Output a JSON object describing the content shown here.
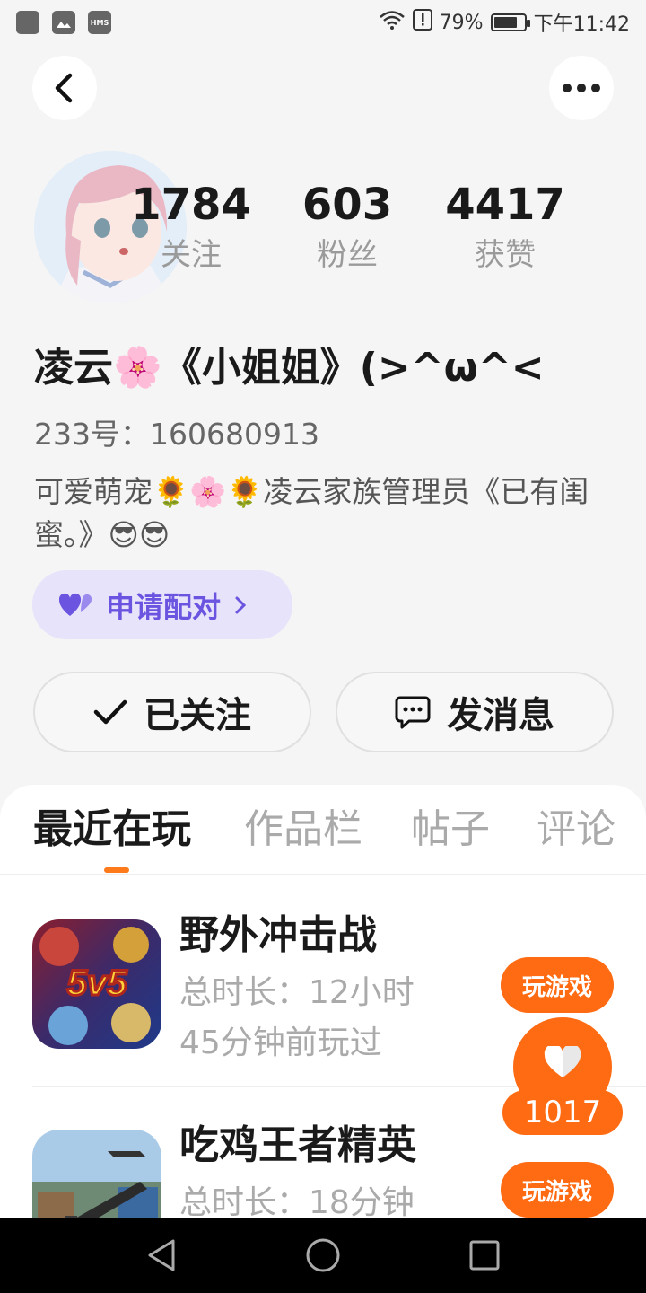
{
  "status_bar": {
    "left_icons": [
      "app-icon",
      "gallery-icon",
      "hms-icon"
    ],
    "hms_label": "HMS",
    "battery_percent": "79%",
    "battery_level": 0.79,
    "time": "下午11:42"
  },
  "profile": {
    "username": "凌云🌸《小姐姐》(>^ω^<",
    "id_label": "233号：160680913",
    "bio": "可爱萌宠🌻🌸🌻凌云家族管理员《已有闺蜜。》😎😎",
    "stats": [
      {
        "value": "1784",
        "label": "关注"
      },
      {
        "value": "603",
        "label": "粉丝"
      },
      {
        "value": "4417",
        "label": "获赞"
      }
    ],
    "pair_label": "申请配对",
    "follow_label": "已关注",
    "message_label": "发消息"
  },
  "tabs": [
    "最近在玩",
    "作品栏",
    "帖子",
    "评论"
  ],
  "active_tab": "最近在玩",
  "games": [
    {
      "name": "野外冲击战",
      "playtime": "总时长：12小时",
      "last_played": "45分钟前玩过",
      "play_label": "玩游戏",
      "icon_text": "5v5"
    },
    {
      "name": "吃鸡王者精英",
      "playtime": "总时长：18分钟",
      "play_label": "玩游戏"
    }
  ],
  "like_count": "1017",
  "colors": {
    "accent": "#ff6b12",
    "pair_bg": "#e6e3fb",
    "pair_text": "#6b54e0"
  }
}
